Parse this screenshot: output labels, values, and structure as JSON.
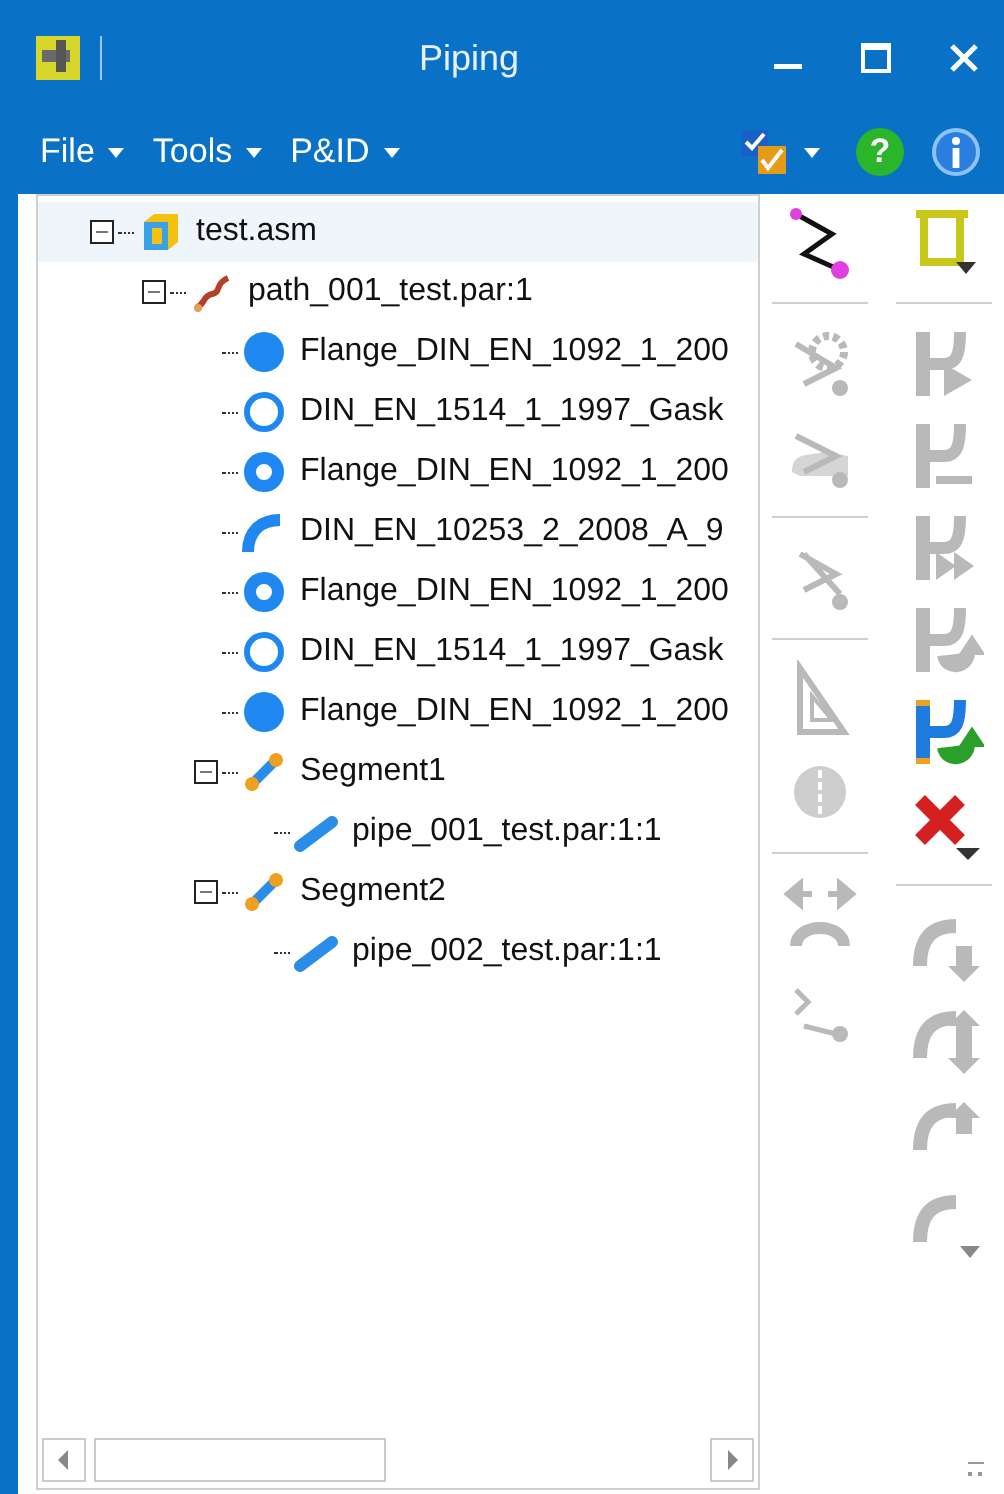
{
  "window": {
    "title": "Piping"
  },
  "menu": [
    {
      "label": "File"
    },
    {
      "label": "Tools"
    },
    {
      "label": "P&ID"
    }
  ],
  "menu_tools": [
    {
      "kind": "check-options"
    },
    {
      "kind": "help",
      "glyph": "?"
    },
    {
      "kind": "info"
    }
  ],
  "tree": [
    {
      "label": "test.asm",
      "kind": "assembly",
      "selected": true,
      "expanded": true,
      "children": [
        {
          "label": "path_001_test.par:1",
          "kind": "path",
          "selected": false,
          "expanded": true,
          "children": [
            {
              "label": "Flange_DIN_EN_1092_1_200",
              "kind": "flange",
              "selected": false
            },
            {
              "label": "DIN_EN_1514_1_1997_Gask",
              "kind": "gasket",
              "selected": false
            },
            {
              "label": "Flange_DIN_EN_1092_1_200",
              "kind": "flange-ring",
              "selected": false
            },
            {
              "label": "DIN_EN_10253_2_2008_A_9",
              "kind": "elbow",
              "selected": false
            },
            {
              "label": "Flange_DIN_EN_1092_1_200",
              "kind": "flange-ring",
              "selected": false
            },
            {
              "label": "DIN_EN_1514_1_1997_Gask",
              "kind": "gasket",
              "selected": false
            },
            {
              "label": "Flange_DIN_EN_1092_1_200",
              "kind": "flange",
              "selected": false
            },
            {
              "label": "Segment1",
              "kind": "segment",
              "selected": false,
              "expanded": true,
              "children": [
                {
                  "label": "pipe_001_test.par:1:1",
                  "kind": "pipe",
                  "selected": false
                }
              ]
            },
            {
              "label": "Segment2",
              "kind": "segment",
              "selected": false,
              "expanded": true,
              "children": [
                {
                  "label": "pipe_002_test.par:1:1",
                  "kind": "pipe",
                  "selected": false
                }
              ]
            }
          ]
        }
      ]
    }
  ],
  "toolbar": {
    "columns": [
      [
        {
          "kind": "route",
          "disabled": false
        },
        {
          "kind": "separator"
        },
        {
          "kind": "gear-route",
          "disabled": true
        },
        {
          "kind": "hand-route",
          "disabled": true
        },
        {
          "kind": "separator"
        },
        {
          "kind": "cut-route",
          "disabled": true
        },
        {
          "kind": "separator"
        },
        {
          "kind": "set-square",
          "disabled": true
        },
        {
          "kind": "split-sphere",
          "disabled": true
        },
        {
          "kind": "separator"
        },
        {
          "kind": "bend-arrows",
          "disabled": true
        },
        {
          "kind": "dimension-route",
          "disabled": true
        }
      ],
      [
        {
          "kind": "bracket-menu",
          "disabled": false
        },
        {
          "kind": "separator"
        },
        {
          "kind": "pipe-play",
          "disabled": true
        },
        {
          "kind": "pipe-wrench",
          "disabled": true
        },
        {
          "kind": "pipe-forward",
          "disabled": true
        },
        {
          "kind": "pipe-cycle",
          "disabled": true
        },
        {
          "kind": "pipe-cycle",
          "disabled": false
        },
        {
          "kind": "delete-menu",
          "disabled": false
        },
        {
          "kind": "separator"
        },
        {
          "kind": "elbow-down",
          "disabled": true
        },
        {
          "kind": "elbow-updown",
          "disabled": true
        },
        {
          "kind": "elbow-up",
          "disabled": true
        },
        {
          "kind": "elbow-menu",
          "disabled": true
        }
      ]
    ]
  }
}
